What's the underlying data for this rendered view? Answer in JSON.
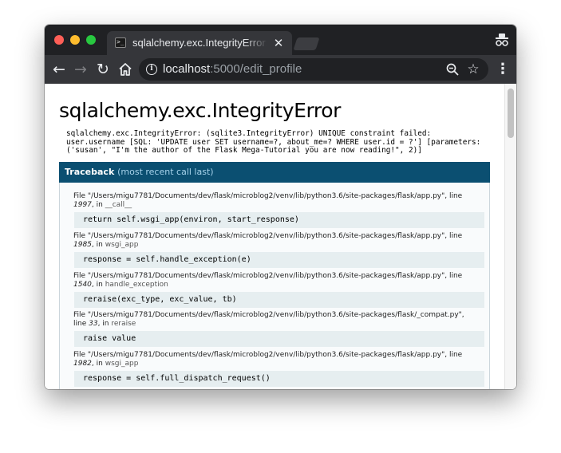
{
  "browser": {
    "tab_title": "sqlalchemy.exc.IntegrityError: ",
    "tab_close": "✕",
    "favicon_glyph": ">_",
    "url_host": "localhost",
    "url_rest": ":5000/edit_profile",
    "info_glyph": "i",
    "icons": [
      "back-arrow-icon",
      "forward-arrow-icon",
      "reload-icon",
      "home-icon",
      "info-icon",
      "zoom-icon",
      "star-icon",
      "menu-icon",
      "incognito-icon"
    ],
    "colors": {
      "tabstrip": "#202124",
      "toolbar": "#35363a",
      "omnibox": "#202124"
    }
  },
  "page": {
    "title": "sqlalchemy.exc.IntegrityError",
    "message": "sqlalchemy.exc.IntegrityError: (sqlite3.IntegrityError) UNIQUE constraint failed:\nuser.username [SQL: 'UPDATE user SET username=?, about_me=? WHERE user.id = ?'] [parameters:\n('susan', \"I'm the author of the Flask Mega-Tutorial you are now reading!\", 2)]",
    "traceback_label": "Traceback",
    "traceback_sub": "(most recent call last)",
    "colors": {
      "header": "#0b4f71",
      "header_sub": "#a6d2ea",
      "code_bg": "#e6eef0"
    },
    "frames": [
      {
        "file_prefix": "File \"/Users/migu7781/Documents/dev/flask/microblog2/venv/lib/python3.6/site-packages/flask/app.py\", line",
        "line": "1997",
        "in_text": ", in ",
        "func": "__call__",
        "code": "return self.wsgi_app(environ, start_response)"
      },
      {
        "file_prefix": "File \"/Users/migu7781/Documents/dev/flask/microblog2/venv/lib/python3.6/site-packages/flask/app.py\", line",
        "line": "1985",
        "in_text": ", in ",
        "func": "wsgi_app",
        "code": "response = self.handle_exception(e)"
      },
      {
        "file_prefix": "File \"/Users/migu7781/Documents/dev/flask/microblog2/venv/lib/python3.6/site-packages/flask/app.py\", line",
        "line": "1540",
        "in_text": ", in ",
        "func": "handle_exception",
        "code": "reraise(exc_type, exc_value, tb)"
      },
      {
        "file_prefix": "File \"/Users/migu7781/Documents/dev/flask/microblog2/venv/lib/python3.6/site-packages/flask/_compat.py\",",
        "line_prefix": "line ",
        "line": "33",
        "in_text": ", in ",
        "func": "reraise",
        "code": "raise value"
      },
      {
        "file_prefix": "File \"/Users/migu7781/Documents/dev/flask/microblog2/venv/lib/python3.6/site-packages/flask/app.py\", line",
        "line": "1982",
        "in_text": ", in ",
        "func": "wsgi_app",
        "code": "response = self.full_dispatch_request()"
      }
    ]
  }
}
